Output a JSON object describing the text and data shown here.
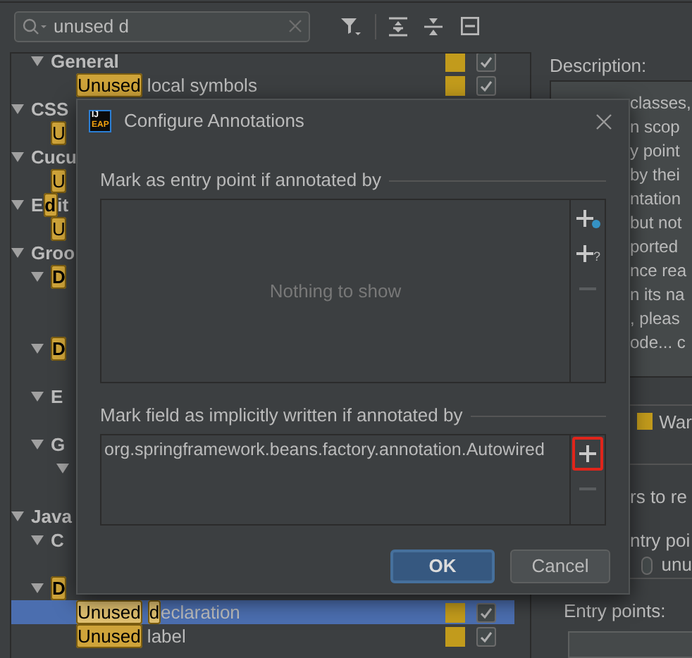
{
  "search": {
    "value": "unused d"
  },
  "tree": [
    {
      "kind": "continued",
      "children": [
        {
          "kind": "group",
          "expanded": true,
          "selected": false,
          "parts": [
            {
              "text": "General",
              "match": false
            }
          ],
          "color": "#c29b1c",
          "checked": true,
          "children": [
            {
              "kind": "item",
              "selected": false,
              "parts": [
                {
                  "text": "Unused",
                  "match": true
                },
                {
                  "text": " local symbols",
                  "match": false
                }
              ],
              "color": "#c29b1c",
              "checked": true
            }
          ]
        }
      ]
    },
    {
      "kind": "group",
      "expanded": true,
      "selected": false,
      "parts": [
        {
          "text": "CSS",
          "match": false
        }
      ],
      "children": [
        {
          "kind": "item",
          "selected": false,
          "parts": [
            {
              "text": "U",
              "match": true
            }
          ]
        }
      ]
    },
    {
      "kind": "group",
      "expanded": true,
      "selected": false,
      "parts": [
        {
          "text": "Cucu",
          "match": false
        }
      ],
      "children": [
        {
          "kind": "item",
          "selected": false,
          "parts": [
            {
              "text": "U",
              "match": true
            }
          ]
        }
      ]
    },
    {
      "kind": "group",
      "expanded": true,
      "selected": false,
      "parts": [
        {
          "text": "E",
          "match": false
        },
        {
          "text": "d",
          "match": true
        },
        {
          "text": "it",
          "match": false
        }
      ],
      "children": [
        {
          "kind": "item",
          "selected": false,
          "parts": [
            {
              "text": "U",
              "match": true
            }
          ]
        }
      ]
    },
    {
      "kind": "group",
      "expanded": true,
      "selected": false,
      "parts": [
        {
          "text": "Groo",
          "match": false
        }
      ],
      "children": [
        {
          "kind": "group",
          "expanded": true,
          "selected": false,
          "parts": [
            {
              "text": "D",
              "match": true
            }
          ],
          "children": [
            {
              "kind": "covered"
            },
            {
              "kind": "covered"
            }
          ]
        },
        {
          "kind": "group",
          "expanded": true,
          "selected": false,
          "parts": [
            {
              "text": "D",
              "match": true
            }
          ],
          "children": [
            {
              "kind": "covered"
            }
          ]
        },
        {
          "kind": "group",
          "expanded": true,
          "selected": false,
          "parts": [
            {
              "text": "E",
              "match": false
            }
          ],
          "children": [
            {
              "kind": "covered"
            }
          ]
        },
        {
          "kind": "group",
          "expanded": true,
          "selected": false,
          "parts": [
            {
              "text": "G",
              "match": false
            }
          ],
          "children": [
            {
              "kind": "group",
              "expanded": true,
              "selected": false,
              "children": [
                {
                  "kind": "covered"
                }
              ]
            }
          ]
        }
      ]
    },
    {
      "kind": "group",
      "expanded": true,
      "selected": false,
      "parts": [
        {
          "text": "Java",
          "match": false
        }
      ],
      "children": [
        {
          "kind": "group",
          "expanded": true,
          "selected": false,
          "parts": [
            {
              "text": "C",
              "match": false
            }
          ],
          "children": [
            {
              "kind": "covered"
            }
          ]
        },
        {
          "kind": "group",
          "expanded": true,
          "selected": false,
          "parts": [
            {
              "text": "D",
              "match": true
            }
          ],
          "children": [
            {
              "kind": "item",
              "selected": true,
              "parts": [
                {
                  "text": "Unused",
                  "match": true
                },
                {
                  "text": "d",
                  "match": true,
                  "spaced": true
                },
                {
                  "text": "eclaration",
                  "match": false
                }
              ],
              "color": "#c29b1c",
              "checked": true
            },
            {
              "kind": "item",
              "selected": false,
              "parts": [
                {
                  "text": "Unused",
                  "match": true
                },
                {
                  "text": " label",
                  "match": false
                }
              ],
              "color": "#c29b1c",
              "checked": true
            }
          ]
        }
      ]
    }
  ],
  "details": {
    "description_label": "Description:",
    "description_lines": [
      "classes,",
      "n scop",
      "y point",
      "by thei",
      "ntation",
      "but not",
      "ported",
      "nce rea",
      "n its na",
      ", pleas",
      "ode... c"
    ],
    "severity": {
      "text": "War",
      "color": "#c29b1c"
    },
    "partial_label": "rs to re",
    "entry_heading": "ntry poi",
    "radio": {
      "label": "unu",
      "selected": false
    },
    "entry_points_label": "Entry points:"
  },
  "dialog": {
    "title": "Configure Annotations",
    "app_icon": [
      "IJ",
      "EAP"
    ],
    "sections": [
      {
        "label": "Mark as entry point if annotated by",
        "empty_text": "Nothing to show",
        "tools": [
          {
            "kind": "add_annotation",
            "disabled": false,
            "highlighted": false
          },
          {
            "kind": "add_pattern",
            "badge": "?",
            "disabled": false,
            "highlighted": false
          },
          {
            "kind": "remove",
            "disabled": true,
            "highlighted": false
          }
        ]
      },
      {
        "label": "Mark field as implicitly written if annotated by",
        "rows": [
          "org.springframework.beans.factory.annotation.Autowired"
        ],
        "tools": [
          {
            "kind": "add",
            "disabled": false,
            "highlighted": true
          },
          {
            "kind": "remove",
            "disabled": true,
            "highlighted": false
          }
        ]
      }
    ],
    "buttons": [
      {
        "label": "OK",
        "default": true
      },
      {
        "label": "Cancel",
        "default": false
      }
    ]
  }
}
